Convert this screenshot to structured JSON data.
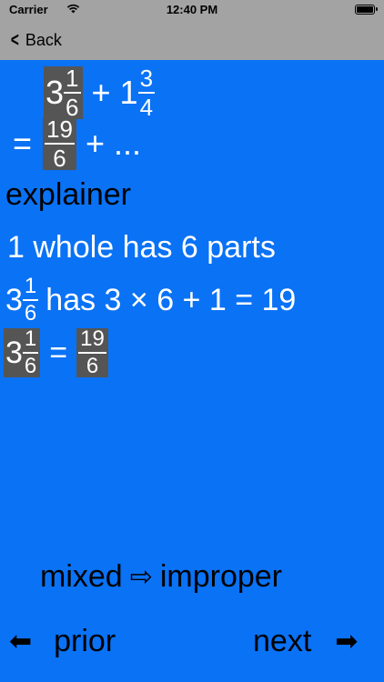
{
  "status": {
    "carrier": "Carrier",
    "time": "12:40 PM"
  },
  "nav": {
    "back": "Back"
  },
  "problem": {
    "whole1": "3",
    "num1": "1",
    "den1": "6",
    "plus": "+",
    "whole2": "1",
    "num2": "3",
    "den2": "4",
    "eq": "=",
    "num3": "19",
    "den3": "6",
    "rest": "+ ..."
  },
  "explainer": {
    "title": "explainer",
    "line1": "1 whole has 6 parts",
    "line2_whole": "3",
    "line2_num": "1",
    "line2_den": "6",
    "line2_text": "has 3 × 6 + 1 =  19",
    "line3_whole": "3",
    "line3_num": "1",
    "line3_den": "6",
    "line3_eq": "=",
    "line3_num2": "19",
    "line3_den2": "6"
  },
  "bottom": {
    "mode_from": "mixed",
    "mode_arrow": "⇨",
    "mode_to": "improper",
    "prior_arrow": "⬅",
    "prior": "prior",
    "next": "next",
    "next_arrow": "➡"
  }
}
